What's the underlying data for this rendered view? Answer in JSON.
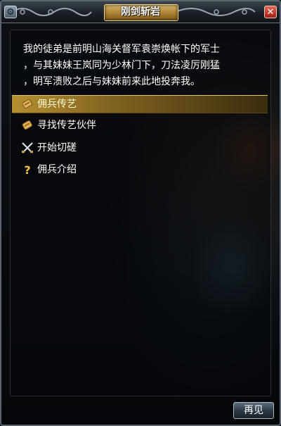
{
  "window": {
    "title": "刚剑斩岩"
  },
  "dialog": {
    "text": "我的徒弟是前明山海关督军袁崇焕帐下的军士\n，与其妹妹王岚同为少林门下，刀法凌厉刚猛\n，明军溃败之后与妹妹前来此地投奔我。"
  },
  "options": [
    {
      "label": "佣兵传艺",
      "icon": "scroll-icon",
      "selected": true
    },
    {
      "label": "寻找传艺伙伴",
      "icon": "scroll-icon",
      "selected": false
    },
    {
      "label": "开始切磋",
      "icon": "crossed-swords-icon",
      "selected": false
    },
    {
      "label": "佣兵介绍",
      "icon": "question-mark-icon",
      "selected": false
    }
  ],
  "footer": {
    "goodbye_label": "再见"
  },
  "colors": {
    "highlight": "#b4902f",
    "title_plaque": "#d8b868",
    "close_button": "#c0392b"
  }
}
